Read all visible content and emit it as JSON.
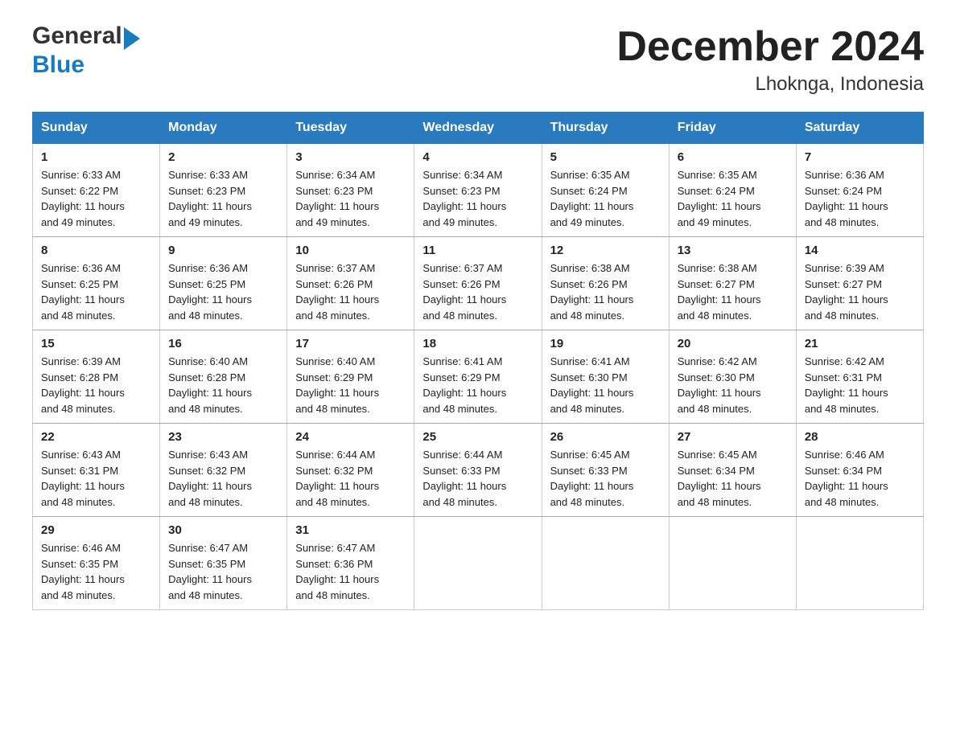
{
  "header": {
    "logo_general": "General",
    "logo_blue": "Blue",
    "title": "December 2024",
    "subtitle": "Lhoknga, Indonesia"
  },
  "columns": [
    "Sunday",
    "Monday",
    "Tuesday",
    "Wednesday",
    "Thursday",
    "Friday",
    "Saturday"
  ],
  "weeks": [
    [
      {
        "day": "1",
        "sunrise": "6:33 AM",
        "sunset": "6:22 PM",
        "daylight": "11 hours and 49 minutes."
      },
      {
        "day": "2",
        "sunrise": "6:33 AM",
        "sunset": "6:23 PM",
        "daylight": "11 hours and 49 minutes."
      },
      {
        "day": "3",
        "sunrise": "6:34 AM",
        "sunset": "6:23 PM",
        "daylight": "11 hours and 49 minutes."
      },
      {
        "day": "4",
        "sunrise": "6:34 AM",
        "sunset": "6:23 PM",
        "daylight": "11 hours and 49 minutes."
      },
      {
        "day": "5",
        "sunrise": "6:35 AM",
        "sunset": "6:24 PM",
        "daylight": "11 hours and 49 minutes."
      },
      {
        "day": "6",
        "sunrise": "6:35 AM",
        "sunset": "6:24 PM",
        "daylight": "11 hours and 49 minutes."
      },
      {
        "day": "7",
        "sunrise": "6:36 AM",
        "sunset": "6:24 PM",
        "daylight": "11 hours and 48 minutes."
      }
    ],
    [
      {
        "day": "8",
        "sunrise": "6:36 AM",
        "sunset": "6:25 PM",
        "daylight": "11 hours and 48 minutes."
      },
      {
        "day": "9",
        "sunrise": "6:36 AM",
        "sunset": "6:25 PM",
        "daylight": "11 hours and 48 minutes."
      },
      {
        "day": "10",
        "sunrise": "6:37 AM",
        "sunset": "6:26 PM",
        "daylight": "11 hours and 48 minutes."
      },
      {
        "day": "11",
        "sunrise": "6:37 AM",
        "sunset": "6:26 PM",
        "daylight": "11 hours and 48 minutes."
      },
      {
        "day": "12",
        "sunrise": "6:38 AM",
        "sunset": "6:26 PM",
        "daylight": "11 hours and 48 minutes."
      },
      {
        "day": "13",
        "sunrise": "6:38 AM",
        "sunset": "6:27 PM",
        "daylight": "11 hours and 48 minutes."
      },
      {
        "day": "14",
        "sunrise": "6:39 AM",
        "sunset": "6:27 PM",
        "daylight": "11 hours and 48 minutes."
      }
    ],
    [
      {
        "day": "15",
        "sunrise": "6:39 AM",
        "sunset": "6:28 PM",
        "daylight": "11 hours and 48 minutes."
      },
      {
        "day": "16",
        "sunrise": "6:40 AM",
        "sunset": "6:28 PM",
        "daylight": "11 hours and 48 minutes."
      },
      {
        "day": "17",
        "sunrise": "6:40 AM",
        "sunset": "6:29 PM",
        "daylight": "11 hours and 48 minutes."
      },
      {
        "day": "18",
        "sunrise": "6:41 AM",
        "sunset": "6:29 PM",
        "daylight": "11 hours and 48 minutes."
      },
      {
        "day": "19",
        "sunrise": "6:41 AM",
        "sunset": "6:30 PM",
        "daylight": "11 hours and 48 minutes."
      },
      {
        "day": "20",
        "sunrise": "6:42 AM",
        "sunset": "6:30 PM",
        "daylight": "11 hours and 48 minutes."
      },
      {
        "day": "21",
        "sunrise": "6:42 AM",
        "sunset": "6:31 PM",
        "daylight": "11 hours and 48 minutes."
      }
    ],
    [
      {
        "day": "22",
        "sunrise": "6:43 AM",
        "sunset": "6:31 PM",
        "daylight": "11 hours and 48 minutes."
      },
      {
        "day": "23",
        "sunrise": "6:43 AM",
        "sunset": "6:32 PM",
        "daylight": "11 hours and 48 minutes."
      },
      {
        "day": "24",
        "sunrise": "6:44 AM",
        "sunset": "6:32 PM",
        "daylight": "11 hours and 48 minutes."
      },
      {
        "day": "25",
        "sunrise": "6:44 AM",
        "sunset": "6:33 PM",
        "daylight": "11 hours and 48 minutes."
      },
      {
        "day": "26",
        "sunrise": "6:45 AM",
        "sunset": "6:33 PM",
        "daylight": "11 hours and 48 minutes."
      },
      {
        "day": "27",
        "sunrise": "6:45 AM",
        "sunset": "6:34 PM",
        "daylight": "11 hours and 48 minutes."
      },
      {
        "day": "28",
        "sunrise": "6:46 AM",
        "sunset": "6:34 PM",
        "daylight": "11 hours and 48 minutes."
      }
    ],
    [
      {
        "day": "29",
        "sunrise": "6:46 AM",
        "sunset": "6:35 PM",
        "daylight": "11 hours and 48 minutes."
      },
      {
        "day": "30",
        "sunrise": "6:47 AM",
        "sunset": "6:35 PM",
        "daylight": "11 hours and 48 minutes."
      },
      {
        "day": "31",
        "sunrise": "6:47 AM",
        "sunset": "6:36 PM",
        "daylight": "11 hours and 48 minutes."
      },
      null,
      null,
      null,
      null
    ]
  ],
  "labels": {
    "sunrise": "Sunrise:",
    "sunset": "Sunset:",
    "daylight": "Daylight:"
  }
}
